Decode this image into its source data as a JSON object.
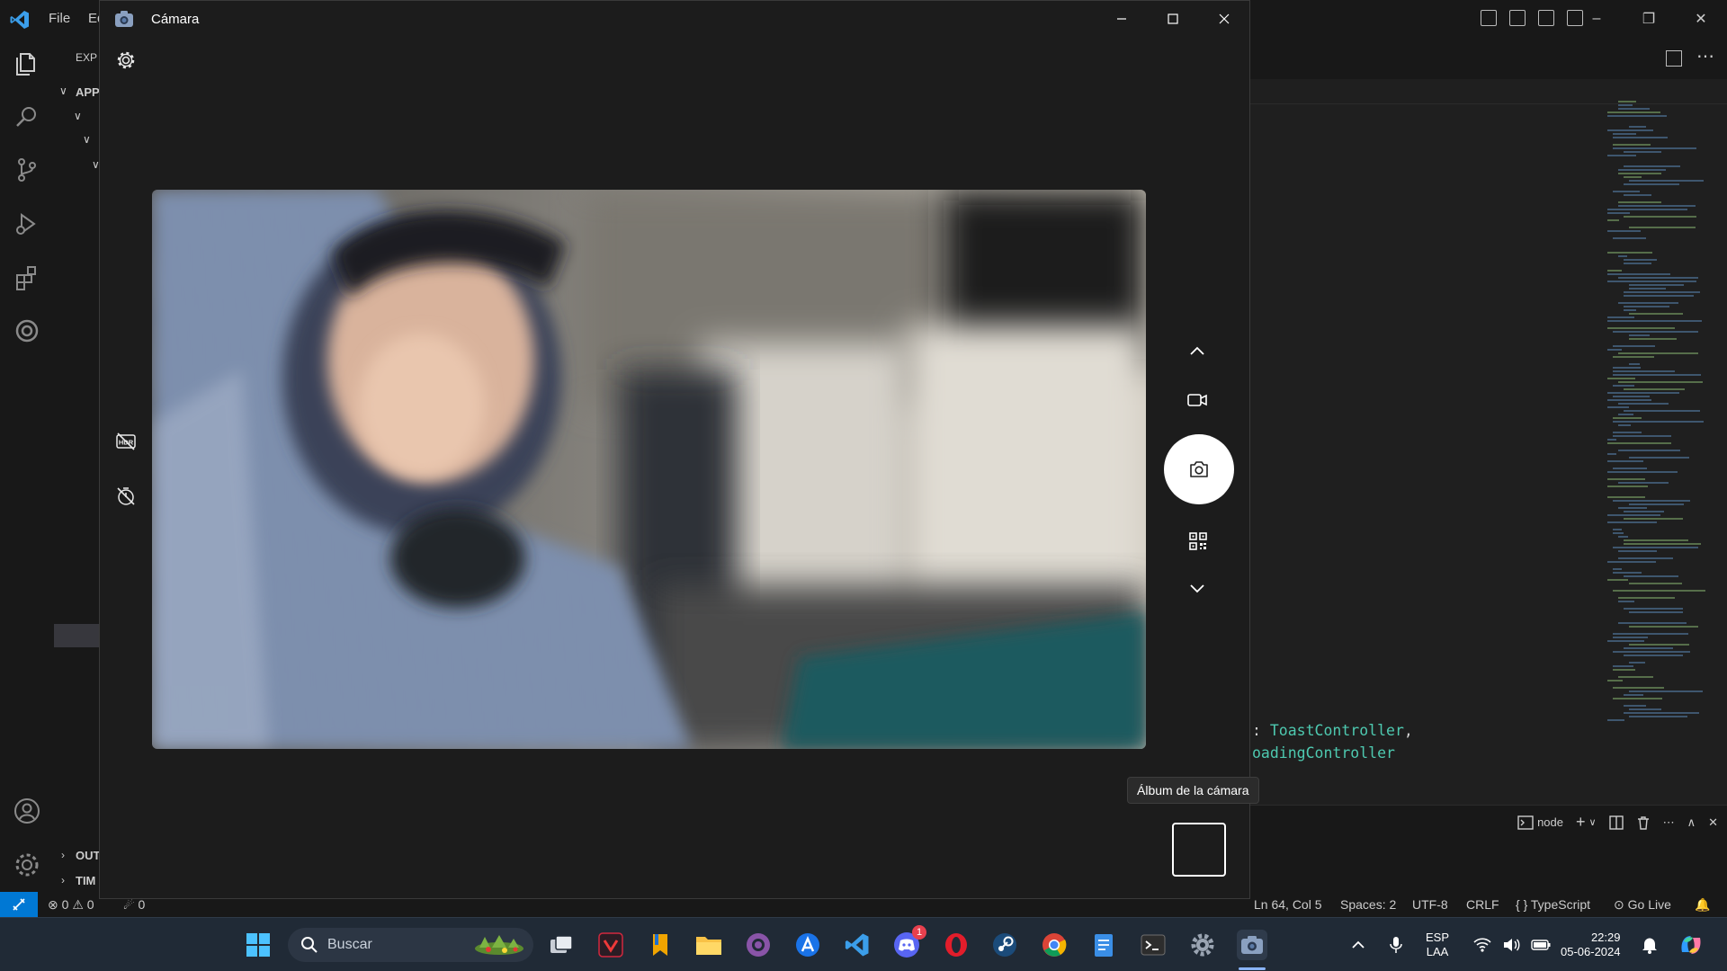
{
  "vscode": {
    "menu": [
      "File",
      "Ed"
    ],
    "explorer_label": "EXP",
    "tree": [
      "APP",
      "OUT",
      "TIM"
    ],
    "code": {
      "line1_prefix": ": ",
      "line1_type": "ToastController",
      "line1_suffix": ",",
      "line2_type": "oadingController"
    },
    "panel": {
      "terminal_label": "node"
    },
    "status": {
      "errors": "0",
      "warnings": "0",
      "ports": "0",
      "position": "Ln 64, Col 5",
      "spaces": "Spaces: 2",
      "encoding": "UTF-8",
      "eol": "CRLF",
      "language": "TypeScript",
      "golive": "Go Live"
    }
  },
  "camera": {
    "title": "Cámara",
    "tooltip": "Álbum de la cámara",
    "icons": {
      "settings": "gear-icon",
      "hdr": "hdr-off-icon",
      "timer": "timer-off-icon",
      "up": "chevron-up-icon",
      "video": "video-camera-icon",
      "photo": "photo-camera-icon",
      "qr": "qr-code-icon",
      "down": "chevron-down-icon"
    }
  },
  "taskbar": {
    "search_placeholder": "Buscar",
    "discord_badge": "1",
    "lang_top": "ESP",
    "lang_bottom": "LAA",
    "time": "22:29",
    "date": "05-06-2024",
    "apps": [
      "start",
      "search",
      "task-view",
      "vivaldi",
      "bookmark",
      "file-explorer",
      "github-desktop",
      "app-a",
      "vscode",
      "discord",
      "opera",
      "steam",
      "chrome",
      "notepad",
      "terminal",
      "settings",
      "camera"
    ]
  },
  "colors": {
    "accent": "#0078d4",
    "type_color": "#4ec9b0",
    "taskbar_bg": "#202a36"
  }
}
